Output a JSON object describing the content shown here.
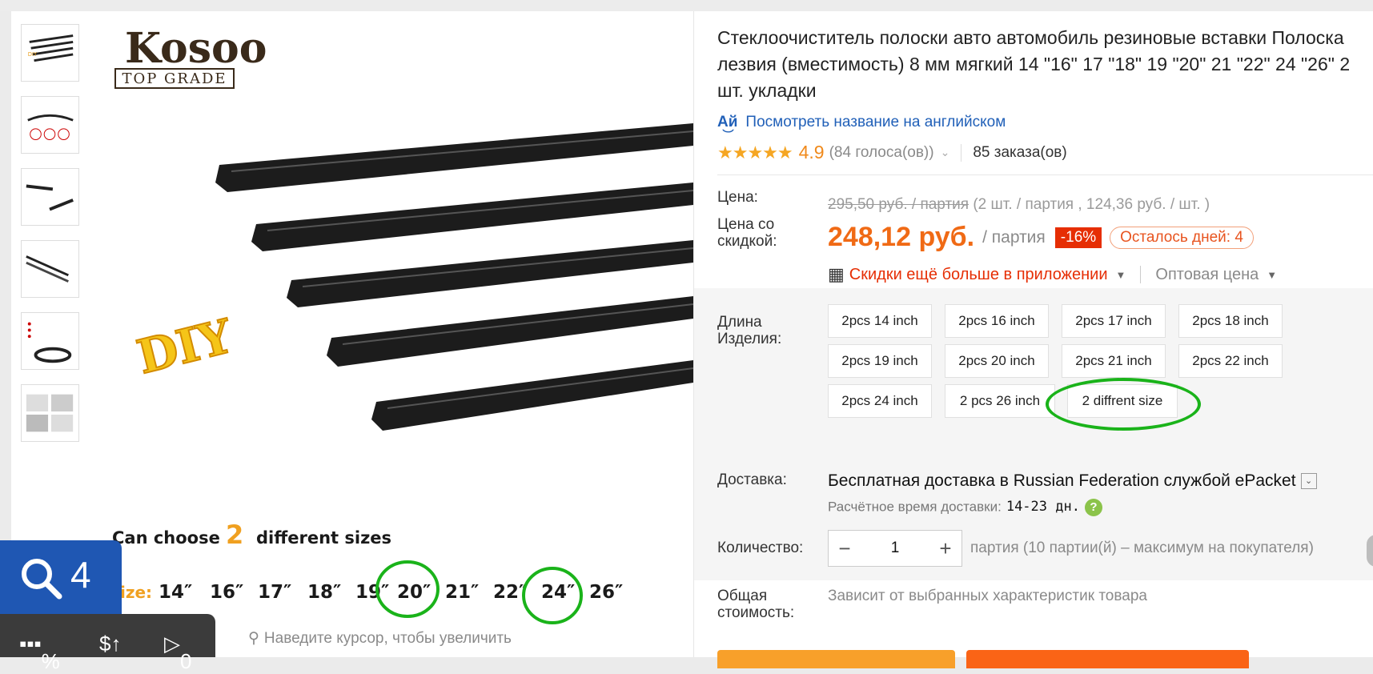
{
  "product": {
    "title": "Стеклоочиститель полоски авто автомобиль резиновые вставки Полоска лезвия (вместимость) 8 мм мягкий 14 \"16\" 17 \"18\" 19 \"20\" 21 \"22\" 24 \"26\" 2 шт. укладки",
    "translate_link": "Посмотреть название на английском",
    "rating_score": "4.9",
    "votes": "(84 голоса(ов))",
    "orders": "85 заказа(ов)"
  },
  "gallery": {
    "brand_main": "Kosoo",
    "brand_sub": "TOP GRADE",
    "diy_text": "DIY",
    "promo_line_a": "Can choose",
    "promo_num": "2",
    "promo_line_b": "different sizes",
    "size_label": "ize:",
    "sizes": [
      "14″",
      "16″",
      "17″",
      "18″",
      "19″",
      "20″",
      "21″",
      "22″",
      "24″",
      "26″"
    ],
    "zoom_hint": "Наведите курсор, чтобы увеличить",
    "thumbnail_count": 6
  },
  "pricing": {
    "price_label": "Цена:",
    "old_price": "295,50 руб. / партия",
    "old_price_note": "(2 шт. / партия , 124,36 руб. / шт. )",
    "discount_label": "Цена со скидкой:",
    "new_price": "248,12 руб.",
    "new_price_unit": "/ партия",
    "discount_badge": "-16%",
    "days_left": "Осталось дней: 4",
    "app_promo": "Скидки ещё больше в приложении",
    "wholesale": "Оптовая цена"
  },
  "options": {
    "label": "Длина Изделия:",
    "items": [
      "2pcs 14 inch",
      "2pcs 16 inch",
      "2pcs 17 inch",
      "2pcs 18 inch",
      "2pcs 19 inch",
      "2pcs 20 inch",
      "2pcs 21 inch",
      "2pcs 22 inch",
      "2pcs 24 inch",
      "2 pcs 26 inch",
      "2 diffrent size"
    ]
  },
  "shipping": {
    "label": "Доставка:",
    "title": "Бесплатная доставка в Russian Federation службой ePacket",
    "time_label": "Расчётное время доставки:",
    "time_value": "14-23 дн."
  },
  "quantity": {
    "label": "Количество:",
    "value": "1",
    "note": "партия (10 партии(й) – максимум на покупателя)"
  },
  "total": {
    "label": "Общая стоимость:",
    "value": "Зависит от выбранных характеристик товара"
  },
  "overlay": {
    "search_count": "4",
    "percent_label": "%",
    "dollar_label": "$↑",
    "play_count": "0"
  },
  "colors": {
    "accent_orange": "#f06a15",
    "discount_red": "#e62e04",
    "link_blue": "#2160b8",
    "highlight_green": "#1ab31a",
    "overlay_blue": "#1f57b3"
  }
}
